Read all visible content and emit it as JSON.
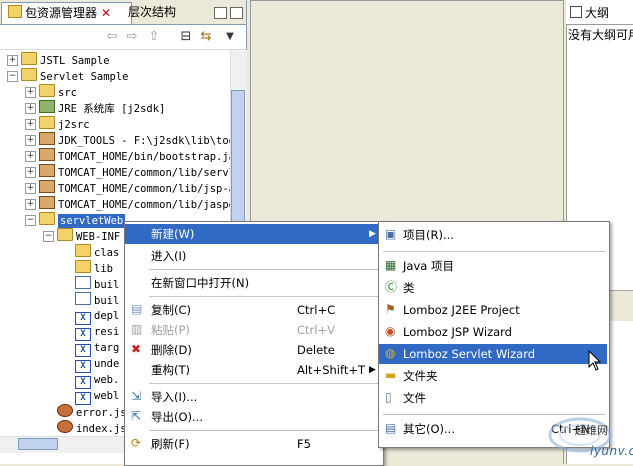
{
  "package_view": {
    "tab_active": "包资源管理器",
    "tab_inactive": "层次结构",
    "close_glyph": "✕"
  },
  "tree": [
    {
      "label": "JSTL Sample",
      "indent": 0,
      "toggle": "+",
      "icon": "project"
    },
    {
      "label": "Servlet Sample",
      "indent": 0,
      "toggle": "-",
      "icon": "project"
    },
    {
      "label": "src",
      "indent": 1,
      "toggle": "+",
      "icon": "package-folder"
    },
    {
      "label": "JRE 系统库 [j2sdk]",
      "indent": 1,
      "toggle": "+",
      "icon": "library"
    },
    {
      "label": "j2src",
      "indent": 1,
      "toggle": "+",
      "icon": "package-folder"
    },
    {
      "label": "JDK_TOOLS - F:\\j2sdk\\lib\\too",
      "indent": 1,
      "toggle": "+",
      "icon": "jar"
    },
    {
      "label": "TOMCAT_HOME/bin/bootstrap.ja",
      "indent": 1,
      "toggle": "+",
      "icon": "jar"
    },
    {
      "label": "TOMCAT_HOME/common/lib/servl",
      "indent": 1,
      "toggle": "+",
      "icon": "jar"
    },
    {
      "label": "TOMCAT_HOME/common/lib/jsp-a",
      "indent": 1,
      "toggle": "+",
      "icon": "jar"
    },
    {
      "label": "TOMCAT_HOME/common/lib/jaspe",
      "indent": 1,
      "toggle": "+",
      "icon": "jar"
    },
    {
      "label": "servletWeb",
      "indent": 1,
      "toggle": "-",
      "icon": "folder",
      "selected": true
    },
    {
      "label": "WEB-INF",
      "indent": 2,
      "toggle": "-",
      "icon": "folder"
    },
    {
      "label": "clas",
      "indent": 3,
      "toggle": "",
      "icon": "folder"
    },
    {
      "label": "lib",
      "indent": 3,
      "toggle": "",
      "icon": "folder"
    },
    {
      "label": "buil",
      "indent": 3,
      "toggle": "",
      "icon": "file"
    },
    {
      "label": "buil",
      "indent": 3,
      "toggle": "",
      "icon": "file"
    },
    {
      "label": "depl",
      "indent": 3,
      "toggle": "",
      "icon": "xml"
    },
    {
      "label": "resi",
      "indent": 3,
      "toggle": "",
      "icon": "xml"
    },
    {
      "label": "targ",
      "indent": 3,
      "toggle": "",
      "icon": "xml"
    },
    {
      "label": "unde",
      "indent": 3,
      "toggle": "",
      "icon": "xml"
    },
    {
      "label": "web.",
      "indent": 3,
      "toggle": "",
      "icon": "xml"
    },
    {
      "label": "webl",
      "indent": 3,
      "toggle": "",
      "icon": "xml"
    },
    {
      "label": "error.js",
      "indent": 2,
      "toggle": "",
      "icon": "jsp"
    },
    {
      "label": "index.js",
      "indent": 2,
      "toggle": "",
      "icon": "jsp"
    }
  ],
  "outline": {
    "tab": "大纲",
    "message": "没有大纲可用"
  },
  "context_menu": [
    {
      "label": "新建(W)",
      "shortcut": "",
      "submenu": true,
      "highlighted": true
    },
    {
      "label": "进入(I)",
      "shortcut": ""
    },
    {
      "separator": true
    },
    {
      "label": "在新窗口中打开(N)",
      "shortcut": ""
    },
    {
      "separator": true
    },
    {
      "label": "复制(C)",
      "shortcut": "Ctrl+C",
      "icon": "copy"
    },
    {
      "label": "粘贴(P)",
      "shortcut": "Ctrl+V",
      "icon": "paste",
      "disabled": true
    },
    {
      "label": "删除(D)",
      "shortcut": "Delete",
      "icon": "delete"
    },
    {
      "label": "重构(T)",
      "shortcut": "Alt+Shift+T",
      "submenu": true
    },
    {
      "separator": true
    },
    {
      "label": "导入(I)...",
      "shortcut": "",
      "icon": "import"
    },
    {
      "label": "导出(O)...",
      "shortcut": "",
      "icon": "export"
    },
    {
      "separator": true
    },
    {
      "label": "刷新(F)",
      "shortcut": "F5",
      "icon": "refresh"
    }
  ],
  "submenu": [
    {
      "label": "项目(R)...",
      "icon": "project"
    },
    {
      "separator": true
    },
    {
      "label": "Java 项目",
      "icon": "java-project"
    },
    {
      "label": "类",
      "icon": "class"
    },
    {
      "label": "Lomboz J2EE Project",
      "icon": "lomboz-j2ee"
    },
    {
      "label": "Lomboz JSP Wizard",
      "icon": "lomboz-jsp"
    },
    {
      "label": "Lomboz Servlet Wizard",
      "icon": "lomboz-servlet",
      "highlighted": true
    },
    {
      "label": "文件夹",
      "icon": "folder"
    },
    {
      "label": "文件",
      "icon": "file"
    },
    {
      "separator": true
    },
    {
      "label": "其它(O)...",
      "shortcut": "Ctrl+N",
      "icon": "other"
    }
  ],
  "watermark": {
    "line1": "超维网",
    "line2": "iyunv.com"
  },
  "colors": {
    "selection": "#316ac5",
    "panel": "#ece9d8",
    "border": "#7f9db9"
  }
}
